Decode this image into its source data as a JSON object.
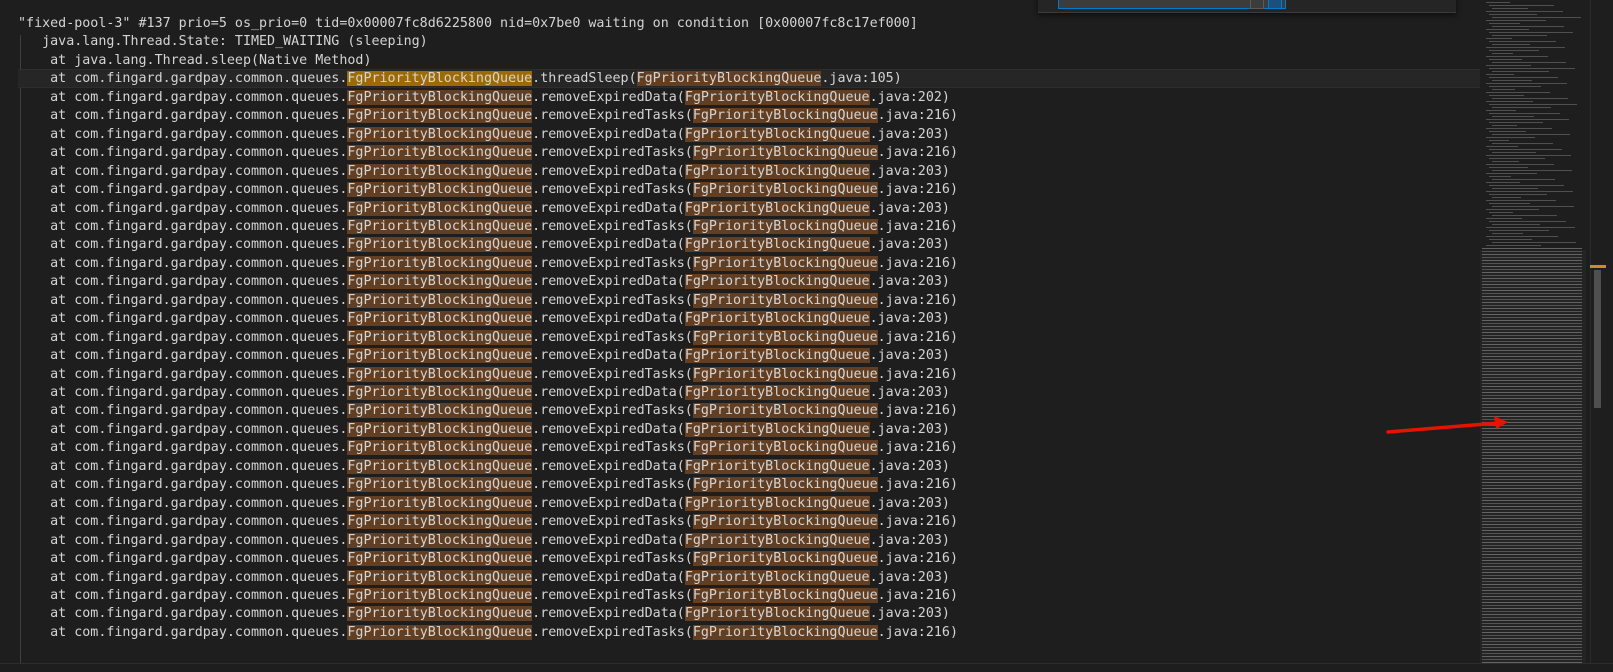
{
  "find": {
    "query": ""
  },
  "highlight_term": "FgPriorityBlockingQueue",
  "lines": [
    "\"fixed-pool-3\" #137 prio=5 os_prio=0 tid=0x00007fc8d6225800 nid=0x7be0 waiting on condition [0x00007fc8c17ef000]",
    "   java.lang.Thread.State: TIMED_WAITING (sleeping)",
    "    at java.lang.Thread.sleep(Native Method)",
    "    at com.fingard.gardpay.common.queues.FgPriorityBlockingQueue.threadSleep(FgPriorityBlockingQueue.java:105)",
    "    at com.fingard.gardpay.common.queues.FgPriorityBlockingQueue.removeExpiredData(FgPriorityBlockingQueue.java:202)",
    "    at com.fingard.gardpay.common.queues.FgPriorityBlockingQueue.removeExpiredTasks(FgPriorityBlockingQueue.java:216)",
    "    at com.fingard.gardpay.common.queues.FgPriorityBlockingQueue.removeExpiredData(FgPriorityBlockingQueue.java:203)",
    "    at com.fingard.gardpay.common.queues.FgPriorityBlockingQueue.removeExpiredTasks(FgPriorityBlockingQueue.java:216)",
    "    at com.fingard.gardpay.common.queues.FgPriorityBlockingQueue.removeExpiredData(FgPriorityBlockingQueue.java:203)",
    "    at com.fingard.gardpay.common.queues.FgPriorityBlockingQueue.removeExpiredTasks(FgPriorityBlockingQueue.java:216)",
    "    at com.fingard.gardpay.common.queues.FgPriorityBlockingQueue.removeExpiredData(FgPriorityBlockingQueue.java:203)",
    "    at com.fingard.gardpay.common.queues.FgPriorityBlockingQueue.removeExpiredTasks(FgPriorityBlockingQueue.java:216)",
    "    at com.fingard.gardpay.common.queues.FgPriorityBlockingQueue.removeExpiredData(FgPriorityBlockingQueue.java:203)",
    "    at com.fingard.gardpay.common.queues.FgPriorityBlockingQueue.removeExpiredTasks(FgPriorityBlockingQueue.java:216)",
    "    at com.fingard.gardpay.common.queues.FgPriorityBlockingQueue.removeExpiredData(FgPriorityBlockingQueue.java:203)",
    "    at com.fingard.gardpay.common.queues.FgPriorityBlockingQueue.removeExpiredTasks(FgPriorityBlockingQueue.java:216)",
    "    at com.fingard.gardpay.common.queues.FgPriorityBlockingQueue.removeExpiredData(FgPriorityBlockingQueue.java:203)",
    "    at com.fingard.gardpay.common.queues.FgPriorityBlockingQueue.removeExpiredTasks(FgPriorityBlockingQueue.java:216)",
    "    at com.fingard.gardpay.common.queues.FgPriorityBlockingQueue.removeExpiredData(FgPriorityBlockingQueue.java:203)",
    "    at com.fingard.gardpay.common.queues.FgPriorityBlockingQueue.removeExpiredTasks(FgPriorityBlockingQueue.java:216)",
    "    at com.fingard.gardpay.common.queues.FgPriorityBlockingQueue.removeExpiredData(FgPriorityBlockingQueue.java:203)",
    "    at com.fingard.gardpay.common.queues.FgPriorityBlockingQueue.removeExpiredTasks(FgPriorityBlockingQueue.java:216)",
    "    at com.fingard.gardpay.common.queues.FgPriorityBlockingQueue.removeExpiredData(FgPriorityBlockingQueue.java:203)",
    "    at com.fingard.gardpay.common.queues.FgPriorityBlockingQueue.removeExpiredTasks(FgPriorityBlockingQueue.java:216)",
    "    at com.fingard.gardpay.common.queues.FgPriorityBlockingQueue.removeExpiredData(FgPriorityBlockingQueue.java:203)",
    "    at com.fingard.gardpay.common.queues.FgPriorityBlockingQueue.removeExpiredTasks(FgPriorityBlockingQueue.java:216)",
    "    at com.fingard.gardpay.common.queues.FgPriorityBlockingQueue.removeExpiredData(FgPriorityBlockingQueue.java:203)",
    "    at com.fingard.gardpay.common.queues.FgPriorityBlockingQueue.removeExpiredTasks(FgPriorityBlockingQueue.java:216)",
    "    at com.fingard.gardpay.common.queues.FgPriorityBlockingQueue.removeExpiredData(FgPriorityBlockingQueue.java:203)",
    "    at com.fingard.gardpay.common.queues.FgPriorityBlockingQueue.removeExpiredTasks(FgPriorityBlockingQueue.java:216)",
    "    at com.fingard.gardpay.common.queues.FgPriorityBlockingQueue.removeExpiredData(FgPriorityBlockingQueue.java:203)",
    "    at com.fingard.gardpay.common.queues.FgPriorityBlockingQueue.removeExpiredTasks(FgPriorityBlockingQueue.java:216)",
    "    at com.fingard.gardpay.common.queues.FgPriorityBlockingQueue.removeExpiredData(FgPriorityBlockingQueue.java:203)",
    "    at com.fingard.gardpay.common.queues.FgPriorityBlockingQueue.removeExpiredTasks(FgPriorityBlockingQueue.java:216)"
  ],
  "current_line_index": 3,
  "colors": {
    "background": "#1e1e1e",
    "text": "#d4d4d4",
    "match": "#623f22",
    "current_match": "#9e6a03",
    "arrow": "#e51400"
  }
}
